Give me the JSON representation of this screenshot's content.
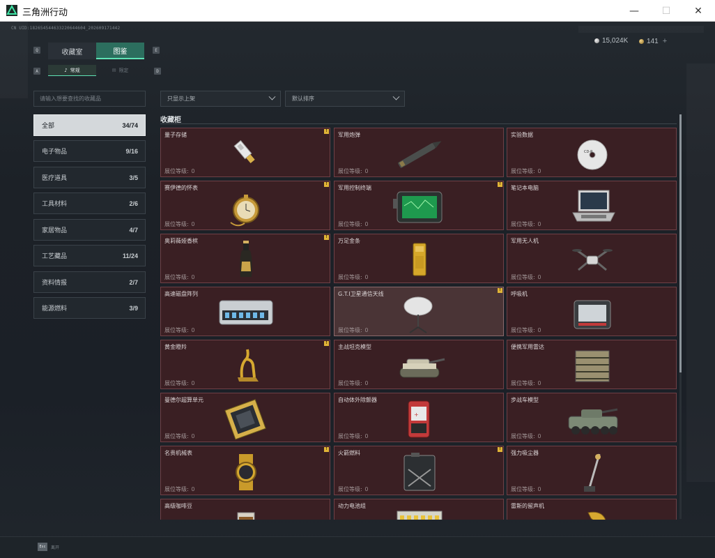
{
  "window": {
    "title": "三角洲行动",
    "min": "—",
    "max": "☐",
    "close": "✕"
  },
  "uid": "CN UID:182654544633220644604_202609171442",
  "currency": {
    "silver": "15,024K",
    "gold": "141",
    "add": "+"
  },
  "tabs": [
    {
      "label": "收藏室",
      "active": false
    },
    {
      "label": "图鉴",
      "active": true
    }
  ],
  "key_hints": {
    "q": "Q",
    "e": "E",
    "a": "A",
    "d": "D"
  },
  "subtabs": [
    {
      "label": "常规",
      "icon": "music-note-icon",
      "active": true
    },
    {
      "label": "限定",
      "icon": "envelope-icon",
      "active": false
    }
  ],
  "search": {
    "placeholder": "请输入想要查找的收藏品",
    "value": ""
  },
  "categories": [
    {
      "label": "全部",
      "count": "34/74",
      "active": true
    },
    {
      "label": "电子物品",
      "count": "9/16",
      "active": false
    },
    {
      "label": "医疗道具",
      "count": "3/5",
      "active": false
    },
    {
      "label": "工具材料",
      "count": "2/6",
      "active": false
    },
    {
      "label": "家居物品",
      "count": "4/7",
      "active": false
    },
    {
      "label": "工艺藏品",
      "count": "11/24",
      "active": false
    },
    {
      "label": "资料情报",
      "count": "2/7",
      "active": false
    },
    {
      "label": "能源燃料",
      "count": "3/9",
      "active": false
    }
  ],
  "filters": {
    "display": "只显示上架",
    "sort": "默认排序"
  },
  "section_title": "收藏柜",
  "level_label": "展位等级:",
  "items": [
    {
      "name": "量子存储",
      "level": "0",
      "alert": true,
      "icon": "usb-drive-icon"
    },
    {
      "name": "军用炮弹",
      "level": "0",
      "alert": false,
      "icon": "artillery-shell-icon"
    },
    {
      "name": "实验数据",
      "level": "0",
      "alert": false,
      "icon": "disc-icon"
    },
    {
      "name": "赛伊德的怀表",
      "level": "0",
      "alert": true,
      "icon": "pocket-watch-icon"
    },
    {
      "name": "军用控制终端",
      "level": "0",
      "alert": true,
      "icon": "control-terminal-icon"
    },
    {
      "name": "笔记本电脑",
      "level": "0",
      "alert": false,
      "icon": "laptop-icon"
    },
    {
      "name": "奥莉薇娅香槟",
      "level": "0",
      "alert": true,
      "icon": "champagne-icon"
    },
    {
      "name": "万足金条",
      "level": "0",
      "alert": false,
      "icon": "gold-bar-icon"
    },
    {
      "name": "军用无人机",
      "level": "0",
      "alert": false,
      "icon": "drone-icon"
    },
    {
      "name": "高速磁盘阵列",
      "level": "0",
      "alert": false,
      "icon": "disk-array-icon"
    },
    {
      "name": "G.T.I卫星通信天线",
      "level": "0",
      "alert": true,
      "icon": "satellite-dish-icon",
      "highlight": true
    },
    {
      "name": "呼吸机",
      "level": "0",
      "alert": false,
      "icon": "ventilator-icon"
    },
    {
      "name": "黄金瞪羚",
      "level": "0",
      "alert": true,
      "icon": "gazelle-statue-icon"
    },
    {
      "name": "主战坦克模型",
      "level": "0",
      "alert": false,
      "icon": "tank-icon"
    },
    {
      "name": "便携军用雷达",
      "level": "0",
      "alert": false,
      "icon": "radar-icon"
    },
    {
      "name": "曼德尔超算单元",
      "level": "0",
      "alert": false,
      "icon": "computing-unit-icon"
    },
    {
      "name": "自动体外除颤器",
      "level": "0",
      "alert": false,
      "icon": "defibrillator-icon"
    },
    {
      "name": "步战车模型",
      "level": "0",
      "alert": false,
      "icon": "ifv-icon"
    },
    {
      "name": "名贵机械表",
      "level": "0",
      "alert": true,
      "icon": "wristwatch-icon"
    },
    {
      "name": "火箭燃料",
      "level": "0",
      "alert": true,
      "icon": "fuel-can-icon"
    },
    {
      "name": "强力吸尘器",
      "level": "0",
      "alert": false,
      "icon": "vacuum-icon"
    },
    {
      "name": "高级咖啡豆",
      "level": "",
      "alert": false,
      "icon": "coffee-bag-icon"
    },
    {
      "name": "动力电池组",
      "level": "",
      "alert": false,
      "icon": "battery-pack-icon"
    },
    {
      "name": "雷斯的留声机",
      "level": "",
      "alert": false,
      "icon": "gramophone-icon"
    }
  ],
  "footer": {
    "esc": "Esc",
    "label": "离开"
  },
  "colors": {
    "accent": "#5fe3b5",
    "card_bg": "#3a1f23",
    "card_border": "#6f4046",
    "alert": "#e0b437"
  }
}
